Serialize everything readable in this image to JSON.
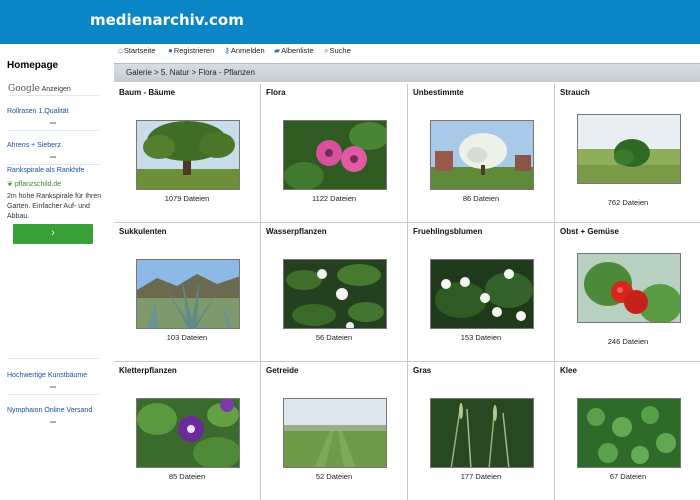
{
  "header": {
    "site_title": "medienarchiv.com"
  },
  "sidebar": {
    "title": "Homepage",
    "ads_label": "Anzeigen",
    "ads_brand": "Google",
    "ads": [
      {
        "link": "Rollrasen 1.Qualität"
      },
      {
        "link": "Ahrens + Sieberz"
      },
      {
        "link": "Rankspirale als Rankhife",
        "domain": "pflanzschild.de",
        "description": "2m hohe Rankspirale für Ihren Garten. Einfacher Auf- und Abbau.",
        "button": "›"
      },
      {
        "link": "Hochwertige Kunstbäume"
      },
      {
        "link": "Nymphaion Online Versand"
      }
    ]
  },
  "topnav": {
    "items": [
      {
        "label": "Startseite",
        "icon": "home-icon"
      },
      {
        "label": "Registrieren",
        "icon": "user-icon"
      },
      {
        "label": "Anmelden",
        "icon": "key-icon"
      },
      {
        "label": "Albenliste",
        "icon": "albums-icon"
      },
      {
        "label": "Suche",
        "icon": "search-icon"
      }
    ]
  },
  "breadcrumb": "Galerie > 5. Natur > Flora - Pflanzen",
  "categories": [
    {
      "title": "Baum - Bäume",
      "count": "1079 Dateien"
    },
    {
      "title": "Flora",
      "count": "1122 Dateien"
    },
    {
      "title": "Unbestimmte",
      "count": "86 Dateien"
    },
    {
      "title": "Strauch",
      "count": "762 Dateien"
    },
    {
      "title": "Sukkulenten",
      "count": "103 Dateien"
    },
    {
      "title": "Wasserpflanzen",
      "count": "56 Dateien"
    },
    {
      "title": "Fruehlingsblumen",
      "count": "153 Dateien"
    },
    {
      "title": "Obst + Gemüse",
      "count": "246 Dateien"
    },
    {
      "title": "Kletterpflanzen",
      "count": "85 Dateien"
    },
    {
      "title": "Getreide",
      "count": "52 Dateien"
    },
    {
      "title": "Gras",
      "count": "177 Dateien"
    },
    {
      "title": "Klee",
      "count": "67 Dateien"
    }
  ]
}
